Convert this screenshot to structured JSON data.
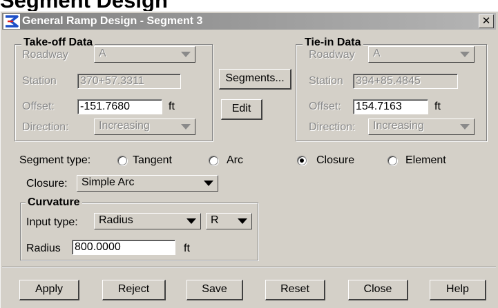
{
  "page_heading": "Segment Design",
  "window": {
    "title": "General Ramp Design - Segment 3",
    "close_glyph": "✕",
    "logo_icon": "ramp-design-logo-icon"
  },
  "takeoff": {
    "title": "Take-off Data",
    "roadway_label": "Roadway",
    "roadway_value": "A",
    "station_label": "Station",
    "station_value": "370+57.3311",
    "offset_label": "Offset:",
    "offset_value": "-151.7680",
    "offset_unit": "ft",
    "direction_label": "Direction:",
    "direction_value": "Increasing"
  },
  "tiein": {
    "title": "Tie-in Data",
    "roadway_label": "Roadway",
    "roadway_value": "A",
    "station_label": "Station",
    "station_value": "394+85.4845",
    "offset_label": "Offset:",
    "offset_value": "154.7163",
    "offset_unit": "ft",
    "direction_label": "Direction:",
    "direction_value": "Increasing"
  },
  "middle_buttons": {
    "segments": "Segments...",
    "edit": "Edit"
  },
  "segment_type": {
    "label": "Segment type:",
    "options": [
      "Tangent",
      "Arc",
      "Closure",
      "Element"
    ],
    "selected": "Closure"
  },
  "closure": {
    "label": "Closure:",
    "value": "Simple Arc"
  },
  "curvature": {
    "title": "Curvature",
    "input_type_label": "Input type:",
    "input_type_value": "Radius",
    "mode_value": "R",
    "radius_label": "Radius",
    "radius_value": "800.0000",
    "radius_unit": "ft"
  },
  "footer_buttons": [
    "Apply",
    "Reject",
    "Save",
    "Reset",
    "Close",
    "Help"
  ]
}
